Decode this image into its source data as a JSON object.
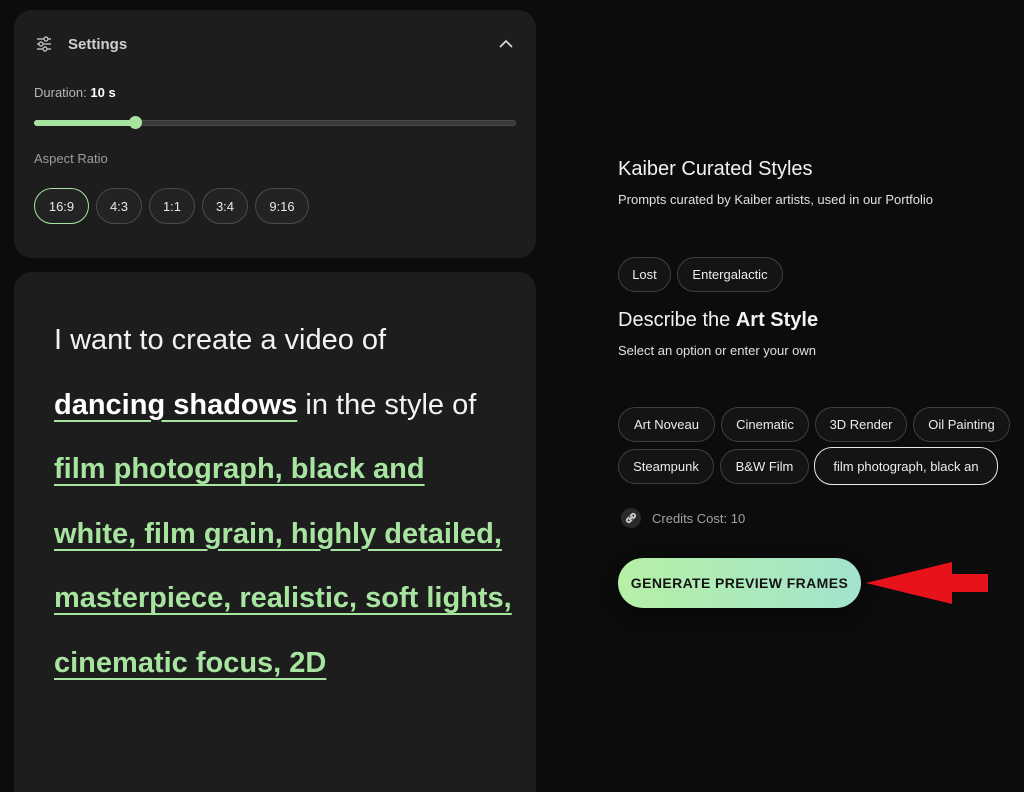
{
  "settings": {
    "title": "Settings",
    "duration_label": "Duration:",
    "duration_value": "10 s",
    "duration_fraction": 0.21,
    "aspect_label": "Aspect Ratio",
    "aspect_options": [
      "16:9",
      "4:3",
      "1:1",
      "3:4",
      "9:16"
    ],
    "aspect_selected": "16:9"
  },
  "prompt": {
    "intro": "I want to create a video of",
    "subject": "dancing shadows",
    "connector": "in the style of",
    "style": "film photograph, black and white, film grain, highly detailed, masterpiece, realistic, soft lights, cinematic focus, 2D"
  },
  "curated": {
    "title": "Kaiber Curated Styles",
    "subtitle": "Prompts curated by Kaiber artists, used in our Portfolio",
    "chips": [
      "Lost",
      "Entergalactic"
    ]
  },
  "art_style": {
    "title_prefix": "Describe the",
    "title_bold": "Art Style",
    "subtitle": "Select an option or enter your own",
    "options": [
      "Art Noveau",
      "Cinematic",
      "3D Render",
      "Oil Painting",
      "Steampunk",
      "B&W Film",
      "film photograph, black an"
    ],
    "selected": "film photograph, black an"
  },
  "credits": {
    "label": "Credits Cost: 10",
    "icon": "link-icon"
  },
  "generate": {
    "label": "GENERATE PREVIEW FRAMES"
  },
  "colors": {
    "accent": "#a7e4a0",
    "annotation_arrow": "#e8121a",
    "background": "#0c0c0d",
    "card": "#1d1d1e"
  }
}
